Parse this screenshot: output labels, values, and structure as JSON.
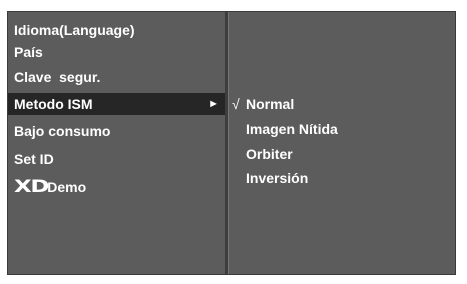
{
  "menu": {
    "items": [
      {
        "label": "Idioma(Language)"
      },
      {
        "label": "País"
      },
      {
        "label": "Clave  segur."
      },
      {
        "label": "Metodo ISM",
        "selected": true,
        "arrow": "►"
      },
      {
        "label": "Bajo consumo"
      },
      {
        "label": "Set ID"
      },
      {
        "label": "Demo",
        "logo": "XD"
      }
    ]
  },
  "submenu": {
    "check_mark": "√",
    "options": [
      {
        "label": "Normal",
        "checked": true
      },
      {
        "label": "Imagen Nítida"
      },
      {
        "label": "Orbiter"
      },
      {
        "label": "Inversión"
      }
    ]
  },
  "colors": {
    "panel": "#5c5c5c",
    "highlight": "#262626",
    "text": "#ffffff"
  }
}
